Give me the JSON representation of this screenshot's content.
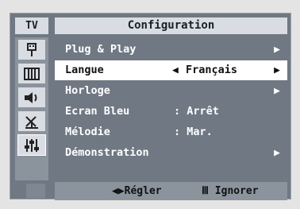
{
  "osd": {
    "tab": "TV",
    "title": "Configuration",
    "side_icons": [
      "plug-icon",
      "picture-icon",
      "sound-icon",
      "antenna-icon",
      "settings-sliders-icon"
    ],
    "menu": [
      {
        "label": "Plug & Play",
        "value": "",
        "arrow": "▶"
      },
      {
        "label": "Langue",
        "value": "Français",
        "left_arrow": "◀",
        "arrow": "▶",
        "selected": true
      },
      {
        "label": "Horloge",
        "value": "",
        "arrow": "▶"
      },
      {
        "label": "Ecran Bleu",
        "value": ": Arrêt",
        "arrow": ""
      },
      {
        "label": "Mélodie",
        "value": ": Mar.",
        "arrow": ""
      },
      {
        "label": "Démonstration",
        "value": "",
        "arrow": "▶"
      }
    ],
    "footer": {
      "adjust": "◀▶Régler",
      "ignore": "Ⅲ Ignorer"
    }
  }
}
